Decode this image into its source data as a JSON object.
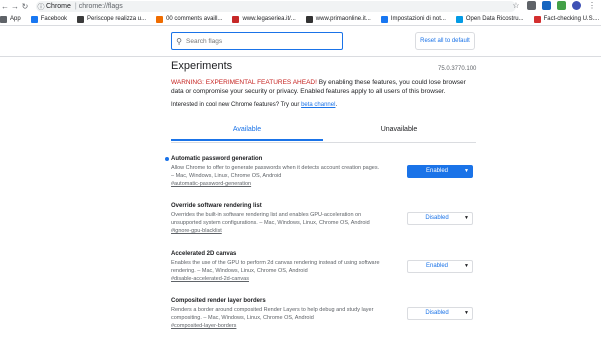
{
  "browser": {
    "site_label": "Chrome",
    "url": "chrome://flags",
    "bookmarks": [
      {
        "label": "App",
        "color": "#5f6368"
      },
      {
        "label": "Facebook",
        "color": "#1877f2"
      },
      {
        "label": "Periscope realizza u...",
        "color": "#3b3b3b"
      },
      {
        "label": "00 comments availl...",
        "color": "#ef6c00"
      },
      {
        "label": "www.legaseriea.it/...",
        "color": "#c62828"
      },
      {
        "label": "www.primaonline.it...",
        "color": "#333333"
      },
      {
        "label": "Impostazioni di not...",
        "color": "#1877f2"
      },
      {
        "label": "Open Data Ricostru...",
        "color": "#039be5"
      },
      {
        "label": "Fact-checking U.S....",
        "color": "#d32f2f"
      }
    ]
  },
  "header": {
    "search_placeholder": "Search flags",
    "reset_label": "Reset all to default"
  },
  "page": {
    "title": "Experiments",
    "version": "75.0.3770.100",
    "warning_prefix": "WARNING: EXPERIMENTAL FEATURES AHEAD!",
    "warning_body": " By enabling these features, you could lose browser data or compromise your security or privacy. Enabled features apply to all users of this browser.",
    "interest_text": "Interested in cool new Chrome features? Try our ",
    "interest_link": "beta channel",
    "interest_end": "."
  },
  "tabs": [
    {
      "label": "Available"
    },
    {
      "label": "Unavailable"
    }
  ],
  "flags": [
    {
      "name": "Automatic password generation",
      "desc": "Allow Chrome to offer to generate passwords when it detects account creation pages. – Mac, Windows, Linux, Chrome OS, Android",
      "anchor": "#automatic-password-generation",
      "value": "Enabled"
    },
    {
      "name": "Override software rendering list",
      "desc": "Overrides the built-in software rendering list and enables GPU-acceleration on unsupported system configurations. – Mac, Windows, Linux, Chrome OS, Android",
      "anchor": "#ignore-gpu-blacklist",
      "value": "Disabled"
    },
    {
      "name": "Accelerated 2D canvas",
      "desc": "Enables the use of the GPU to perform 2d canvas rendering instead of using software rendering. – Mac, Windows, Linux, Chrome OS, Android",
      "anchor": "#disable-accelerated-2d-canvas",
      "value": "Enabled"
    },
    {
      "name": "Composited render layer borders",
      "desc": "Renders a border around composited Render Layers to help debug and study layer compositing. – Mac, Windows, Linux, Chrome OS, Android",
      "anchor": "#composited-layer-borders",
      "value": "Disabled"
    }
  ]
}
